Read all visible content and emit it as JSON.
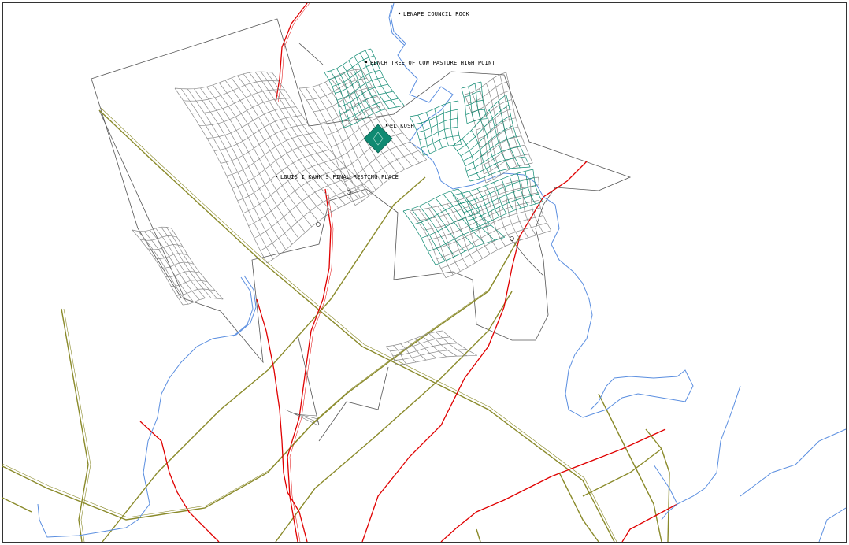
{
  "colors": {
    "road_red": "#e00000",
    "road_olive": "#8a8a2a",
    "river_blue": "#5a8ee0",
    "grid_gray": "#8a8a8a",
    "grid_teal": "#0f8a72",
    "boundary": "#555555",
    "frame": "#333333"
  },
  "labels": {
    "lenape": "LENAPE COUNCIL ROCK",
    "bench": "BENCH TREE OF COW PASTURE HIGH POINT",
    "elkosh": "EL KOSH",
    "kahn": "LOUIS I KAHN'S FINAL RESTING PLACE"
  },
  "icons": {
    "marker": "bullet-marker-icon",
    "site": "site-diamond-icon"
  }
}
